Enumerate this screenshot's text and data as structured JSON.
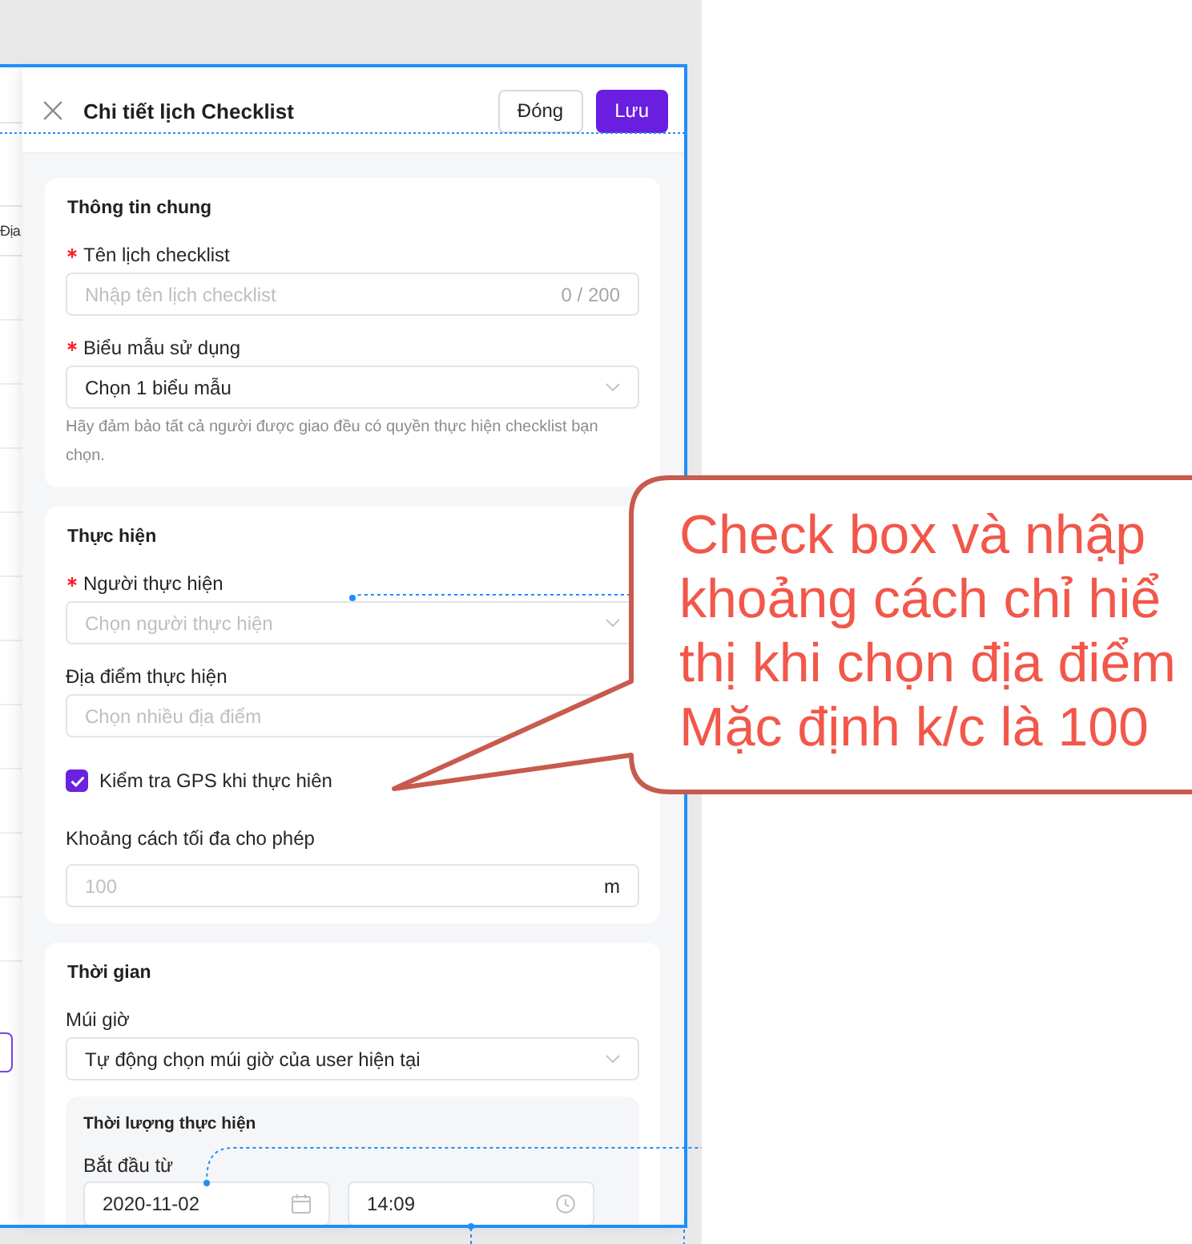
{
  "background": {
    "column_header": "Địa"
  },
  "header": {
    "title": "Chi tiết lịch Checklist",
    "buttons": [
      {
        "label": "Đóng",
        "kind": "secondary"
      },
      {
        "label": "Lưu",
        "kind": "primary"
      }
    ]
  },
  "sections": [
    {
      "title": "Thông tin chung",
      "fields": [
        {
          "kind": "text",
          "label": "Tên lịch checklist",
          "required": true,
          "placeholder": "Nhập tên lịch checklist",
          "counter": "0 / 200"
        },
        {
          "kind": "select",
          "label": "Biểu mẫu sử dụng",
          "required": true,
          "value": "Chọn 1 biểu mẫu",
          "hint": "Hãy đảm bảo tất cả người được giao đều có quyền thực hiện checklist bạn chọn."
        }
      ]
    },
    {
      "title": "Thực hiện",
      "fields": [
        {
          "kind": "select",
          "label": "Người thực hiện",
          "required": true,
          "placeholder": "Chọn người thực hiện"
        },
        {
          "kind": "multiselect",
          "label": "Địa điểm thực hiện",
          "required": false,
          "placeholder": "Chọn nhiều địa điểm"
        },
        {
          "kind": "checkbox",
          "label": "Kiểm tra GPS khi thực hiên",
          "checked": true
        },
        {
          "kind": "number",
          "label": "Khoảng cách tối đa cho phép",
          "required": false,
          "placeholder": "100",
          "suffix": "m"
        }
      ]
    },
    {
      "title": "Thời gian",
      "fields": [
        {
          "kind": "select",
          "label": "Múi giờ",
          "required": false,
          "value": "Tự động chọn múi giờ của user hiện tại"
        },
        {
          "kind": "group",
          "title": "Thời lượng thực hiện",
          "label": "Bắt đầu từ",
          "date": "2020-11-02",
          "time": "14:09"
        }
      ]
    }
  ],
  "annotation": {
    "lines": [
      "Check box và nhập",
      "khoảng cách chỉ hiể",
      "thị khi chọn địa điểm",
      "Mặc định k/c là 100"
    ]
  }
}
